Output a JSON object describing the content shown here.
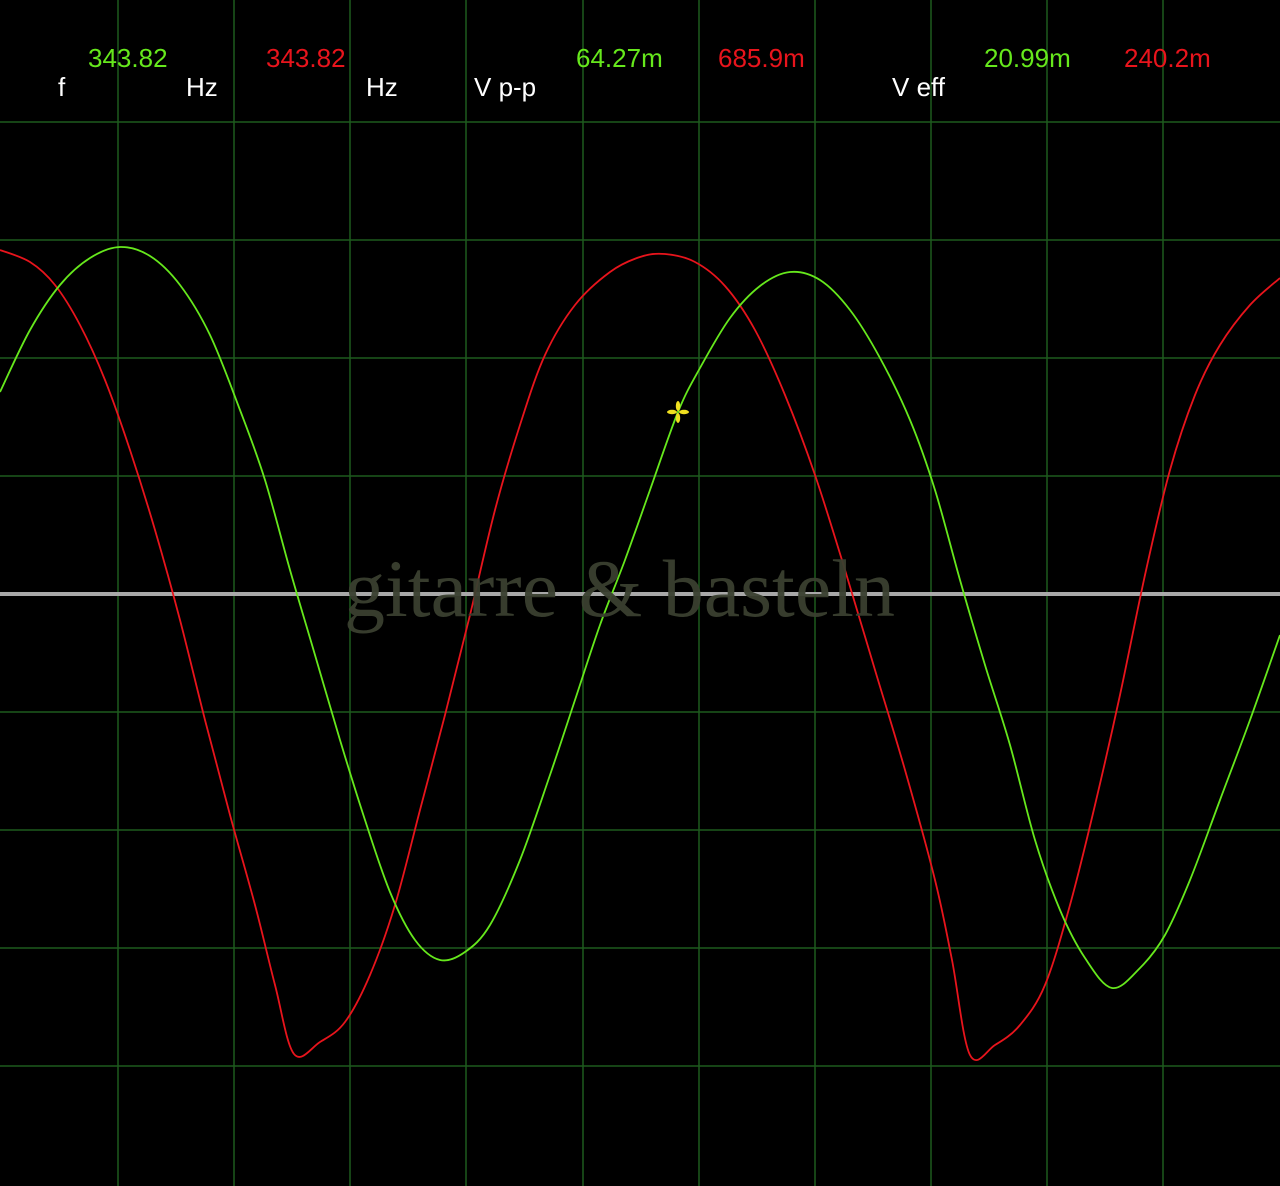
{
  "readouts": {
    "freq": {
      "label": "f",
      "ch1_value": "343.82",
      "ch1_unit": "Hz",
      "ch2_value": "343.82",
      "ch2_unit": "Hz"
    },
    "vpp": {
      "label": "V p-p",
      "ch1_value": "64.27m",
      "ch2_value": "685.9m"
    },
    "veff": {
      "label": "V eff",
      "ch1_value": "20.99m",
      "ch2_value": "240.2m"
    }
  },
  "watermark": "gitarre & basteln",
  "colors": {
    "background": "#000000",
    "grid": "#1e5a1e",
    "zero_line": "#a8a8a8",
    "channel1": "#66e81c",
    "channel2": "#e8141c",
    "cursor": "#f0e020",
    "label_text": "#ffffff"
  },
  "icons": {
    "cursor": "crosshair-cursor-icon"
  },
  "scope": {
    "grid": true,
    "zero_line": true
  }
}
